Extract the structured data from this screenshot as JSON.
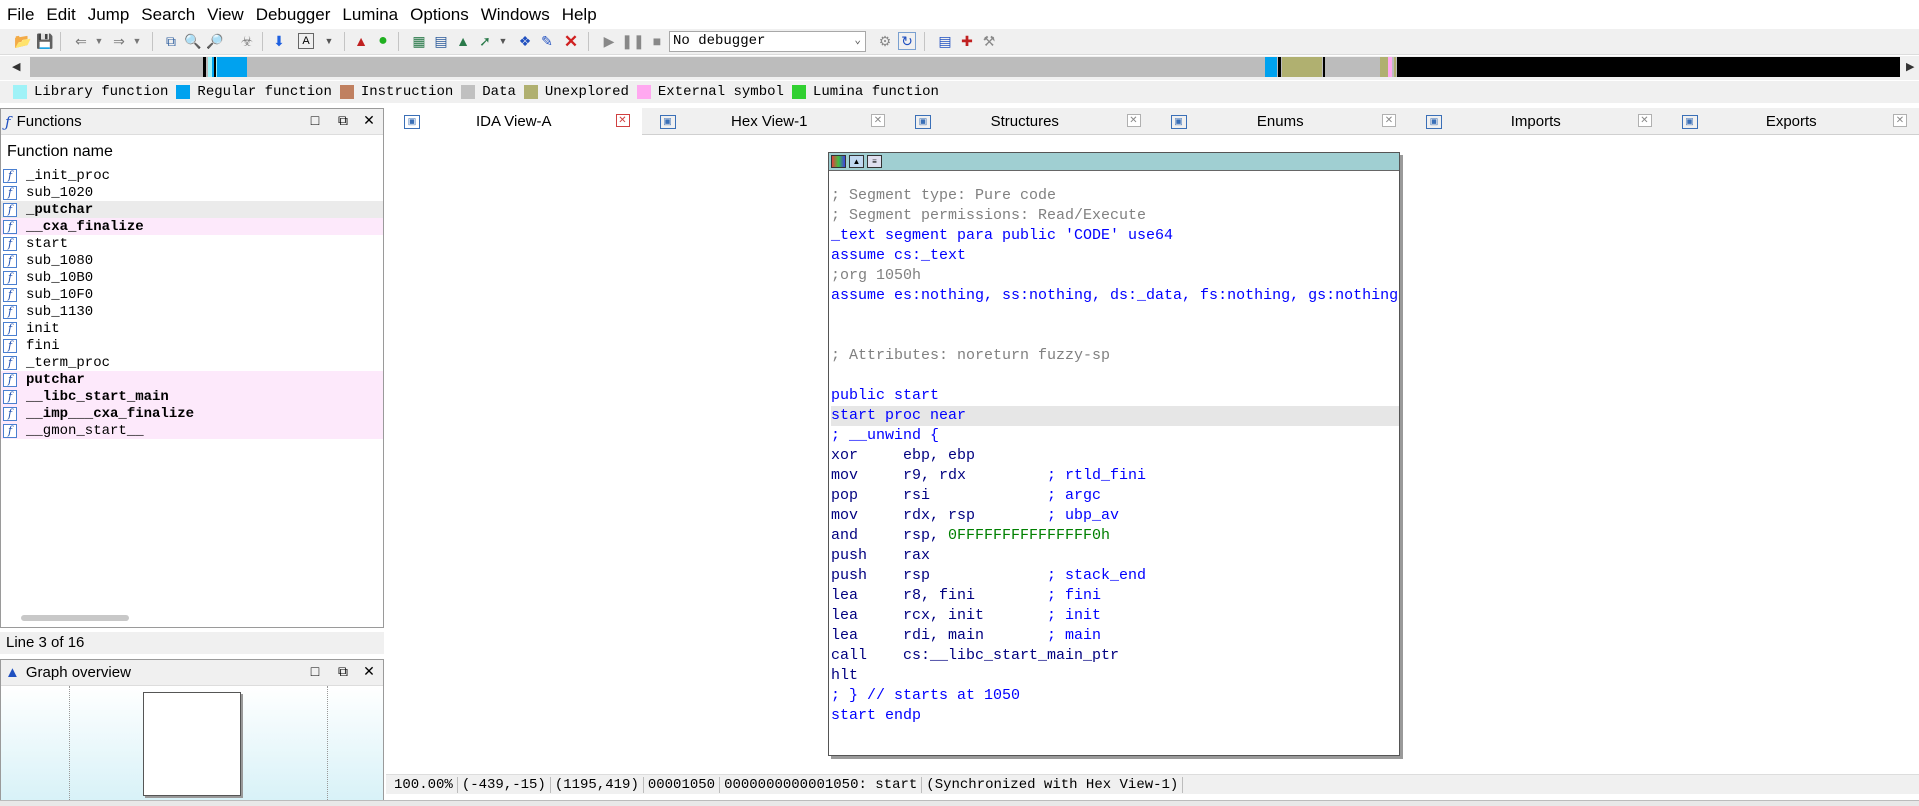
{
  "menu": [
    "File",
    "Edit",
    "Jump",
    "Search",
    "View",
    "Debugger",
    "Lumina",
    "Options",
    "Windows",
    "Help"
  ],
  "toolbar": {
    "debugger_select": "No debugger",
    "icons": [
      "open-icon",
      "save-icon",
      "back-icon",
      "forward-icon",
      "copy-icon",
      "find-icon",
      "find-next-icon",
      "binary-search-icon",
      "jump-down-icon",
      "text-icon",
      "graph-icon",
      "run-circle-icon",
      "struct-add-icon",
      "enum-add-icon",
      "xref-icon",
      "arrow-icon",
      "patch-icon",
      "script-icon",
      "stop-red-icon",
      "play-icon",
      "pause-icon",
      "stop-icon",
      "attach-icon",
      "step-icon",
      "breakpoint-icon",
      "add-breakpoint-icon",
      "tools-icon"
    ]
  },
  "legend": [
    {
      "label": "Library function",
      "color": "#9ff2f7"
    },
    {
      "label": "Regular function",
      "color": "#00a2ef"
    },
    {
      "label": "Instruction",
      "color": "#c08060"
    },
    {
      "label": "Data",
      "color": "#c0c0c0"
    },
    {
      "label": "Unexplored",
      "color": "#b0b070"
    },
    {
      "label": "External symbol",
      "color": "#ffa8f0"
    },
    {
      "label": "Lumina function",
      "color": "#30d030"
    }
  ],
  "functions_panel": {
    "title": "Functions",
    "header": "Function name",
    "items": [
      {
        "name": "_init_proc",
        "bold": false,
        "ext": false
      },
      {
        "name": "sub_1020",
        "bold": false,
        "ext": false
      },
      {
        "name": "_putchar",
        "bold": true,
        "ext": false
      },
      {
        "name": "__cxa_finalize",
        "bold": true,
        "ext": true
      },
      {
        "name": "start",
        "bold": false,
        "ext": false
      },
      {
        "name": "sub_1080",
        "bold": false,
        "ext": false
      },
      {
        "name": "sub_10B0",
        "bold": false,
        "ext": false
      },
      {
        "name": "sub_10F0",
        "bold": false,
        "ext": false
      },
      {
        "name": "sub_1130",
        "bold": false,
        "ext": false
      },
      {
        "name": "init",
        "bold": false,
        "ext": false
      },
      {
        "name": "fini",
        "bold": false,
        "ext": false
      },
      {
        "name": "_term_proc",
        "bold": false,
        "ext": false
      },
      {
        "name": "putchar",
        "bold": true,
        "ext": true
      },
      {
        "name": "__libc_start_main",
        "bold": true,
        "ext": true
      },
      {
        "name": "__imp___cxa_finalize",
        "bold": true,
        "ext": true
      },
      {
        "name": "__gmon_start__",
        "bold": false,
        "ext": true
      }
    ],
    "status": "Line 3 of 16"
  },
  "graph_overview": {
    "title": "Graph overview"
  },
  "tabs": [
    {
      "label": "IDA View-A",
      "icon": "ida-view-icon",
      "active": true
    },
    {
      "label": "Hex View-1",
      "icon": "hex-view-icon",
      "active": false
    },
    {
      "label": "Structures",
      "icon": "structures-icon",
      "active": false
    },
    {
      "label": "Enums",
      "icon": "enums-icon",
      "active": false
    },
    {
      "label": "Imports",
      "icon": "imports-icon",
      "active": false
    },
    {
      "label": "Exports",
      "icon": "exports-icon",
      "active": false
    }
  ],
  "disasm": [
    {
      "segs": [
        {
          "t": "; Segment type: Pure code",
          "c": "cm"
        }
      ]
    },
    {
      "segs": [
        {
          "t": "; Segment permissions: Read/Execute",
          "c": "cm"
        }
      ]
    },
    {
      "segs": [
        {
          "t": "_text segment para public 'CODE' use64",
          "c": "bl"
        }
      ]
    },
    {
      "segs": [
        {
          "t": "assume cs:_text",
          "c": "bl"
        }
      ]
    },
    {
      "segs": [
        {
          "t": ";org 1050h",
          "c": "cm"
        }
      ]
    },
    {
      "segs": [
        {
          "t": "assume es:nothing, ss:nothing, ds:_data, fs:nothing, gs:nothing",
          "c": "bl"
        }
      ]
    },
    {
      "segs": []
    },
    {
      "segs": []
    },
    {
      "segs": [
        {
          "t": "; Attributes: noreturn fuzzy-sp",
          "c": "cm"
        }
      ]
    },
    {
      "segs": []
    },
    {
      "segs": [
        {
          "t": "public start",
          "c": "bl"
        }
      ]
    },
    {
      "segs": [
        {
          "t": "start proc near",
          "c": "bl"
        }
      ],
      "hl": true
    },
    {
      "segs": [
        {
          "t": "; __unwind {",
          "c": "bl"
        }
      ]
    },
    {
      "segs": [
        {
          "t": "xor     ebp, ebp",
          "c": "bk"
        }
      ]
    },
    {
      "segs": [
        {
          "t": "mov     r9, rdx         ",
          "c": "bk"
        },
        {
          "t": "; rtld_fini",
          "c": "bl"
        }
      ]
    },
    {
      "segs": [
        {
          "t": "pop     rsi             ",
          "c": "bk"
        },
        {
          "t": "; argc",
          "c": "bl"
        }
      ]
    },
    {
      "segs": [
        {
          "t": "mov     rdx, rsp        ",
          "c": "bk"
        },
        {
          "t": "; ubp_av",
          "c": "bl"
        }
      ]
    },
    {
      "segs": [
        {
          "t": "and     rsp, ",
          "c": "bk"
        },
        {
          "t": "0FFFFFFFFFFFFFFF0h",
          "c": "gr"
        }
      ]
    },
    {
      "segs": [
        {
          "t": "push    rax",
          "c": "bk"
        }
      ]
    },
    {
      "segs": [
        {
          "t": "push    rsp             ",
          "c": "bk"
        },
        {
          "t": "; stack_end",
          "c": "bl"
        }
      ]
    },
    {
      "segs": [
        {
          "t": "lea     r8, fini        ",
          "c": "bk"
        },
        {
          "t": "; fini",
          "c": "bl"
        }
      ]
    },
    {
      "segs": [
        {
          "t": "lea     rcx, init       ",
          "c": "bk"
        },
        {
          "t": "; init",
          "c": "bl"
        }
      ]
    },
    {
      "segs": [
        {
          "t": "lea     rdi, main       ",
          "c": "bk"
        },
        {
          "t": "; main",
          "c": "bl"
        }
      ]
    },
    {
      "segs": [
        {
          "t": "call    cs:__libc_start_main_ptr",
          "c": "bk"
        }
      ]
    },
    {
      "segs": [
        {
          "t": "hlt",
          "c": "bk"
        }
      ]
    },
    {
      "segs": [
        {
          "t": "; } // starts at 1050",
          "c": "bl"
        }
      ]
    },
    {
      "segs": [
        {
          "t": "start endp",
          "c": "bl"
        }
      ]
    }
  ],
  "status_bar": [
    "100.00%",
    "(-439,-15)",
    "(1195,419)",
    "00001050",
    "0000000000001050: start",
    "(Synchronized with Hex View-1)"
  ]
}
